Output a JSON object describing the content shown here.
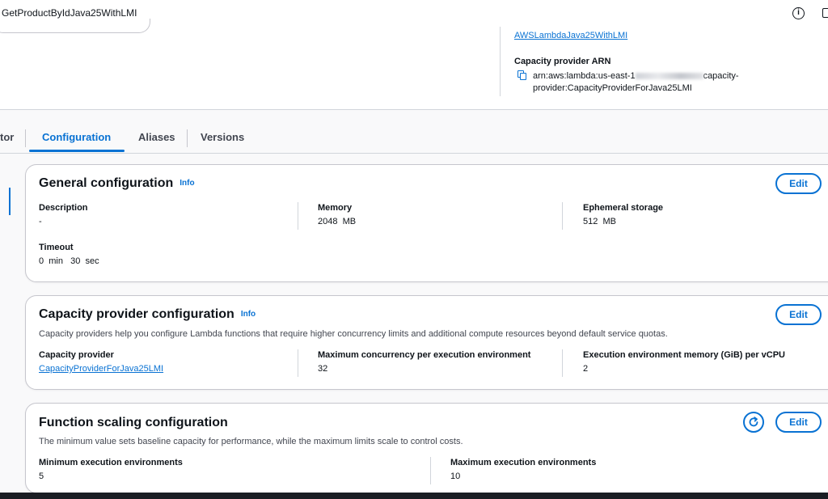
{
  "header": {
    "function_name": "GetProductByIdJava25WithLMI"
  },
  "summary": {
    "role_link": "AWSLambdaJava25WithLMI",
    "capacity_provider_arn_label": "Capacity provider ARN",
    "arn_prefix": "arn:aws:lambda:us-east-1",
    "arn_suffix": "capacity-provider:CapacityProviderForJava25LMI"
  },
  "tabs": [
    {
      "label": "tor"
    },
    {
      "label": "Configuration"
    },
    {
      "label": "Aliases"
    },
    {
      "label": "Versions"
    }
  ],
  "general": {
    "title": "General configuration",
    "info": "Info",
    "edit": "Edit",
    "description_label": "Description",
    "description_value": "-",
    "memory_label": "Memory",
    "memory_value": "2048  MB",
    "ephemeral_label": "Ephemeral storage",
    "ephemeral_value": "512  MB",
    "timeout_label": "Timeout",
    "timeout_value": "0  min   30  sec"
  },
  "capacity": {
    "title": "Capacity provider configuration",
    "info": "Info",
    "edit": "Edit",
    "description": "Capacity providers help you configure Lambda functions that require higher concurrency limits and additional compute resources beyond default service quotas.",
    "provider_label": "Capacity provider",
    "provider_value": "CapacityProviderForJava25LMI",
    "max_concurrency_label": "Maximum concurrency per execution environment",
    "max_concurrency_value": "32",
    "memory_per_vcpu_label": "Execution environment memory (GiB) per vCPU",
    "memory_per_vcpu_value": "2"
  },
  "scaling": {
    "title": "Function scaling configuration",
    "edit": "Edit",
    "description": "The minimum value sets baseline capacity for performance, while the maximum limits scale to control costs.",
    "min_label": "Minimum execution environments",
    "min_value": "5",
    "max_label": "Maximum execution environments",
    "max_value": "10"
  },
  "colors": {
    "accent": "#0972d3",
    "text": "#0f141a",
    "border": "#c6c6cd"
  }
}
